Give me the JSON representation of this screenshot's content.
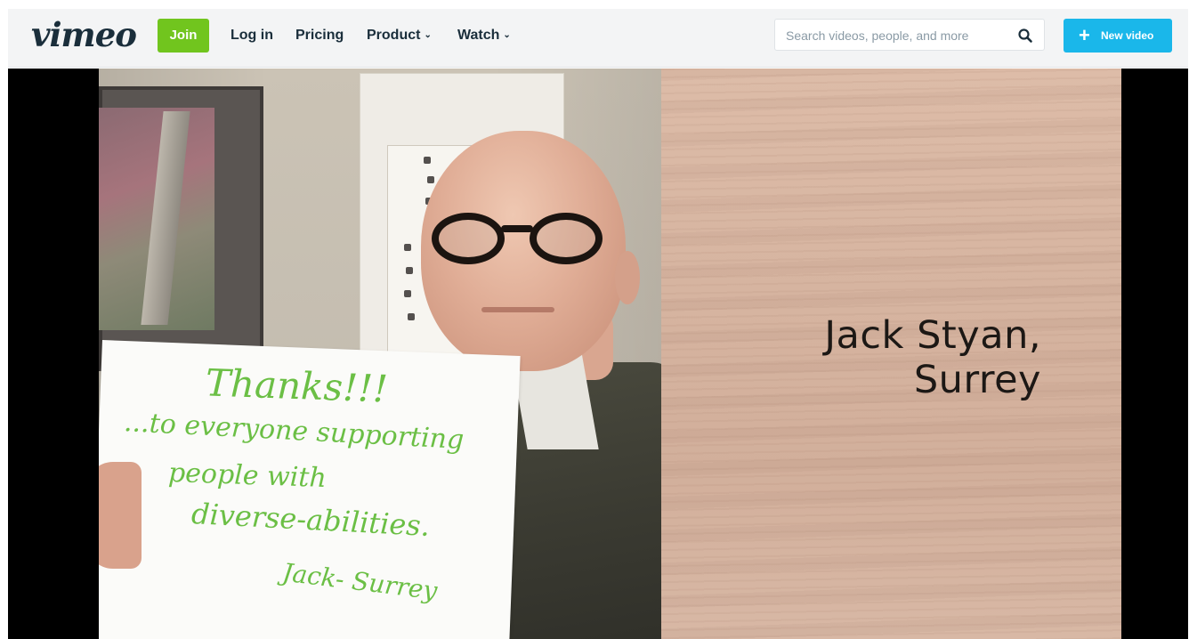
{
  "nav": {
    "logo": "vimeo",
    "join_label": "Join",
    "login_label": "Log in",
    "pricing_label": "Pricing",
    "product_label": "Product",
    "watch_label": "Watch",
    "chevron": "⌄",
    "search_placeholder": "Search videos, people, and more",
    "new_video_label": "New video",
    "plus": "+"
  },
  "video": {
    "sign_lines": [
      "Thanks!!!",
      "...to everyone supporting",
      "people with",
      "diverse-abilities.",
      "Jack- Surrey"
    ],
    "caption_line1": "Jack Styan,",
    "caption_line2": "Surrey"
  },
  "colors": {
    "join_green": "#71c51e",
    "new_video_blue": "#1ab7ea",
    "logo_navy": "#1a2e3b",
    "sign_green": "#6bbf45"
  },
  "icons": [
    "search-icon",
    "plus-icon",
    "chevron-down-icon"
  ]
}
